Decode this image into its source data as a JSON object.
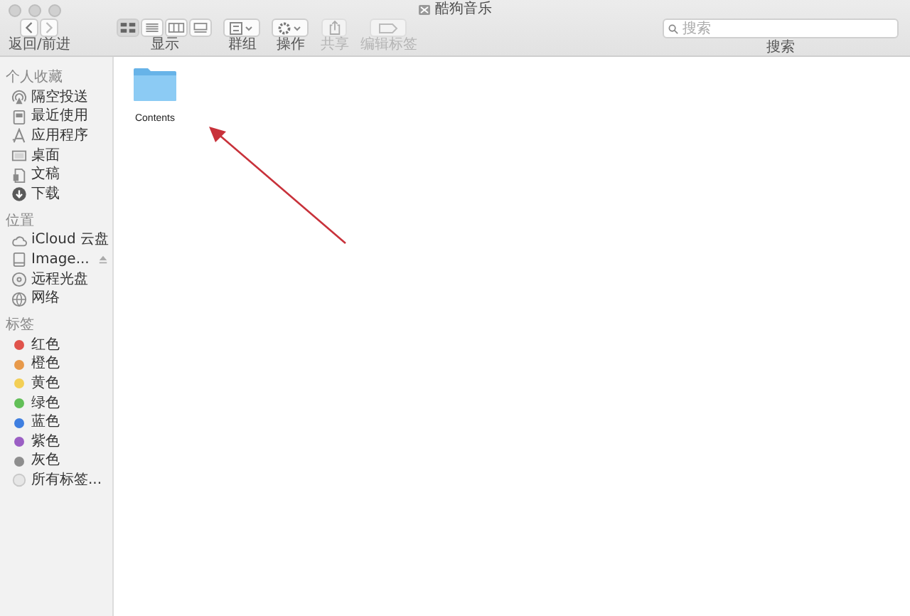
{
  "window": {
    "title": "酷狗音乐"
  },
  "toolbar": {
    "groups": [
      {
        "kind": "nav",
        "label": "返回/前进",
        "disabled": false
      },
      {
        "kind": "view",
        "label": "显示",
        "disabled": false,
        "modes": [
          {
            "kind": "icons",
            "selected": true
          },
          {
            "kind": "list",
            "selected": false
          },
          {
            "kind": "columns",
            "selected": false
          },
          {
            "kind": "gallery",
            "selected": false
          }
        ]
      },
      {
        "kind": "group",
        "label": "群组",
        "disabled": false
      },
      {
        "kind": "action",
        "label": "操作",
        "disabled": false
      },
      {
        "kind": "share",
        "label": "共享",
        "disabled": true
      },
      {
        "kind": "tags",
        "label": "编辑标签",
        "disabled": true
      }
    ],
    "search": {
      "placeholder": "搜索",
      "label": "搜索"
    }
  },
  "sidebar": {
    "sections": [
      {
        "title": "个人收藏",
        "items": [
          {
            "kind": "airdrop",
            "label": "隔空投送"
          },
          {
            "kind": "recent",
            "label": "最近使用"
          },
          {
            "kind": "apps",
            "label": "应用程序"
          },
          {
            "kind": "desktop",
            "label": "桌面"
          },
          {
            "kind": "documents",
            "label": "文稿"
          },
          {
            "kind": "downloads",
            "label": "下载"
          }
        ]
      },
      {
        "title": "位置",
        "items": [
          {
            "kind": "cloud",
            "label": "iCloud 云盘"
          },
          {
            "kind": "disk",
            "label": "Image..."
          },
          {
            "kind": "remote-disc",
            "label": "远程光盘"
          },
          {
            "kind": "network",
            "label": "网络"
          }
        ]
      },
      {
        "title": "标签",
        "items": [
          {
            "kind": "tag",
            "label": "红色",
            "color": "#e0534b"
          },
          {
            "kind": "tag",
            "label": "橙色",
            "color": "#e7994a"
          },
          {
            "kind": "tag",
            "label": "黄色",
            "color": "#f3cf55"
          },
          {
            "kind": "tag",
            "label": "绿色",
            "color": "#62bf58"
          },
          {
            "kind": "tag",
            "label": "蓝色",
            "color": "#3f7fe0"
          },
          {
            "kind": "tag",
            "label": "紫色",
            "color": "#9b5fc4"
          },
          {
            "kind": "tag",
            "label": "灰色",
            "color": "#8e8e8e"
          },
          {
            "kind": "all-tags",
            "label": "所有标签..."
          }
        ]
      }
    ]
  },
  "files": [
    {
      "name": "Contents"
    }
  ]
}
